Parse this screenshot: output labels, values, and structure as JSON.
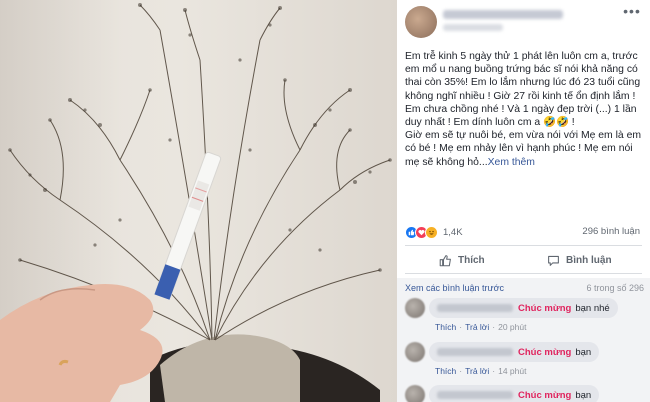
{
  "post": {
    "body": "Em trễ kinh 5 ngày thử 1 phát lên luôn cm a, trước em mổ u nang buồng trứng bác sĩ nói khả năng có thai còn 35%! Em lo lắm nhưng lúc đó 23 tuổi cũng không nghĩ nhiều ! Giờ 27 rồi kinh tế ổn định lắm ! Em chưa chồng nhé ! Và 1 ngày đẹp trời (...) 1 lần duy nhất ! Em dính luôn cm a 🤣🤣 !\nGiờ em sẽ tự nuôi bé, em vừa nói với Mẹ em là em có bé ! Mẹ em nhảy lên vì hạnh phúc ! Mẹ em nói mẹ sẽ không hỏ...",
    "see_more": "Xem thêm",
    "more_icon": "•••"
  },
  "reactions": {
    "icons": [
      "like",
      "love",
      "haha"
    ],
    "count": "1,4K",
    "comments": "296 bình luận"
  },
  "actions": {
    "like": "Thích",
    "comment": "Bình luận"
  },
  "comments_section": {
    "view_previous": "Xem các bình luận trước",
    "count_of": "6 trong số 296",
    "items": [
      {
        "highlight": "Chúc mừng",
        "rest": "bạn nhé",
        "like": "Thích",
        "reply": "Trả lời",
        "time": "20 phút"
      },
      {
        "highlight": "Chúc mừng",
        "rest": "bạn",
        "like": "Thích",
        "reply": "Trả lời",
        "time": "14 phút"
      },
      {
        "highlight": "Chúc mừng",
        "rest": "bạn",
        "like": "",
        "reply": "",
        "time": ""
      }
    ]
  },
  "colors": {
    "link": "#385898",
    "highlight": "#e0245e",
    "like_blue": "#1877f2"
  }
}
